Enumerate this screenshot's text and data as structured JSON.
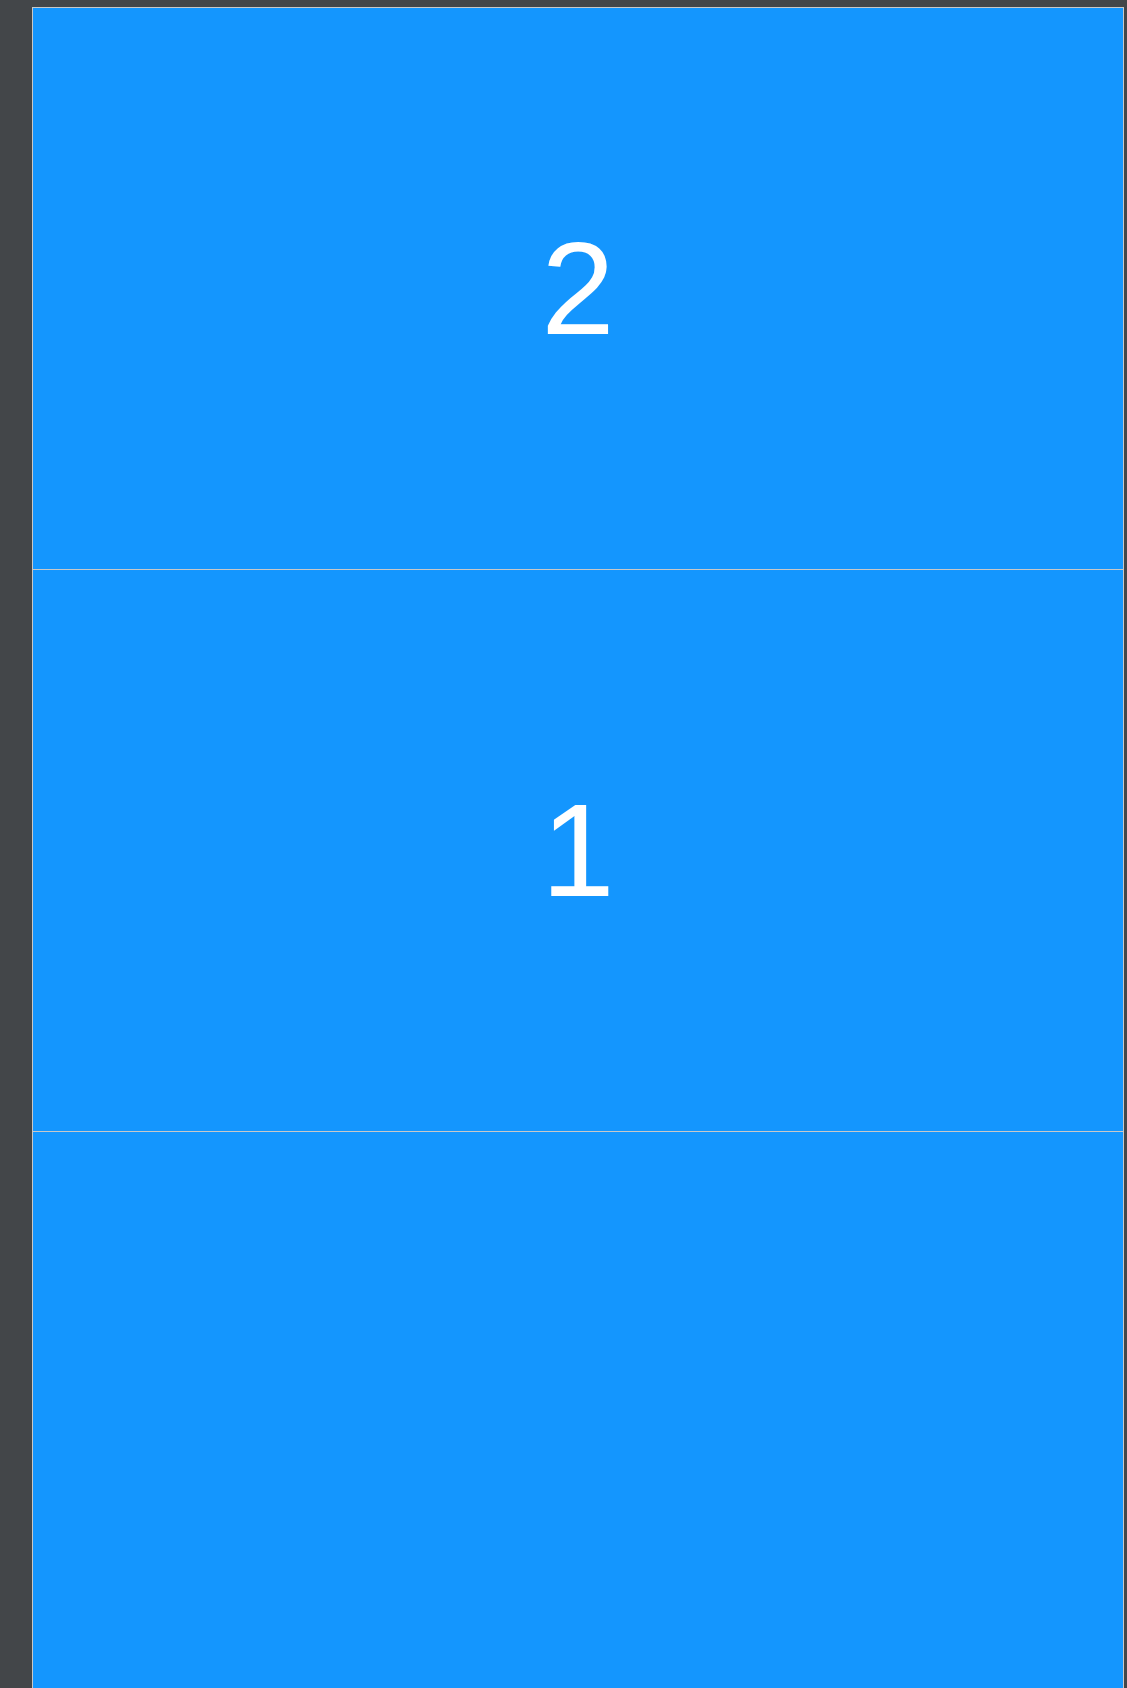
{
  "cells": [
    {
      "kind": "number",
      "label": "2"
    },
    {
      "kind": "number",
      "label": "1"
    },
    {
      "kind": "blank"
    }
  ]
}
